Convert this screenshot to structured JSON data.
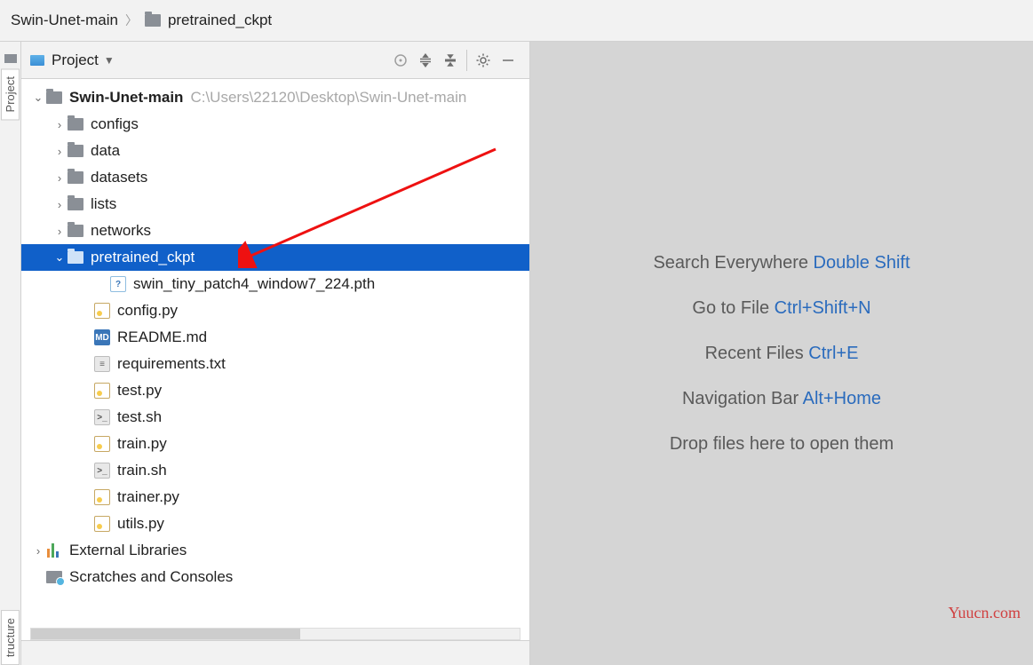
{
  "breadcrumb": {
    "root": "Swin-Unet-main",
    "current": "pretrained_ckpt"
  },
  "sidebar_tabs": {
    "project": "Project",
    "structure": "tructure"
  },
  "panel": {
    "title": "Project"
  },
  "tree": {
    "root": {
      "name": "Swin-Unet-main",
      "path": "C:\\Users\\22120\\Desktop\\Swin-Unet-main"
    },
    "folders": {
      "configs": "configs",
      "data": "data",
      "datasets": "datasets",
      "lists": "lists",
      "networks": "networks",
      "pretrained_ckpt": "pretrained_ckpt"
    },
    "pth_file": "swin_tiny_patch4_window7_224.pth",
    "files": {
      "config_py": "config.py",
      "readme": "README.md",
      "requirements": "requirements.txt",
      "test_py": "test.py",
      "test_sh": "test.sh",
      "train_py": "train.py",
      "train_sh": "train.sh",
      "trainer_py": "trainer.py",
      "utils_py": "utils.py"
    },
    "external": "External Libraries",
    "scratches": "Scratches and Consoles"
  },
  "editor_hints": {
    "search": {
      "label": "Search Everywhere ",
      "key": "Double Shift"
    },
    "goto": {
      "label": "Go to File ",
      "key": "Ctrl+Shift+N"
    },
    "recent": {
      "label": "Recent Files ",
      "key": "Ctrl+E"
    },
    "nav": {
      "label": "Navigation Bar ",
      "key": "Alt+Home"
    },
    "drop": "Drop files here to open them"
  },
  "watermark": "Yuucn.com"
}
